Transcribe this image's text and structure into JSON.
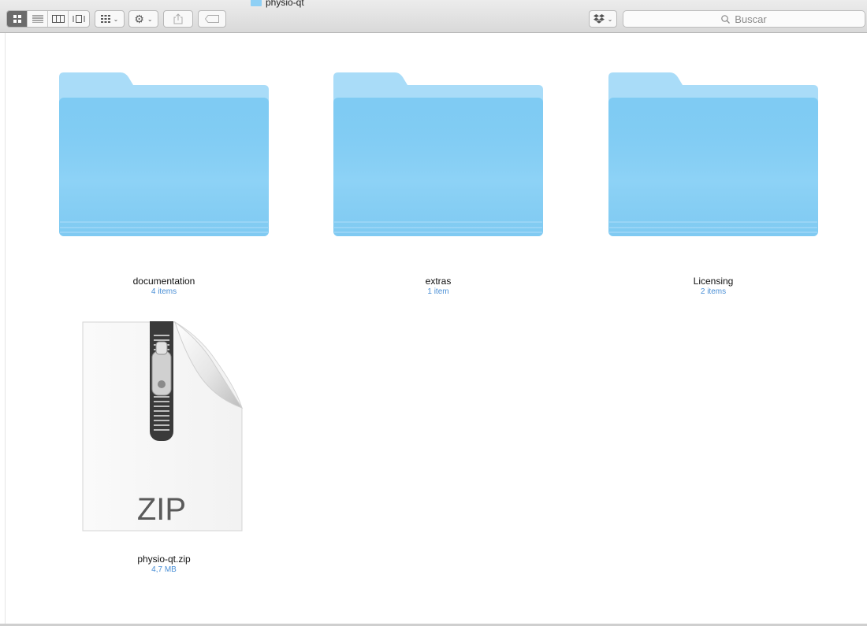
{
  "window": {
    "title": "physio-qt"
  },
  "toolbar": {
    "view_buttons": [
      "icon-view-icon",
      "list-view-icon",
      "column-view-icon",
      "cover-flow-view-icon"
    ],
    "arrange_icon": "arrange-icon",
    "action_icon": "gear-icon",
    "share_icon": "share-icon",
    "tag_icon": "tag-icon",
    "dropbox_icon": "dropbox-icon"
  },
  "search": {
    "placeholder": "Buscar"
  },
  "items": [
    {
      "name": "documentation",
      "sub": "4 items",
      "kind": "folder"
    },
    {
      "name": "extras",
      "sub": "1 item",
      "kind": "folder"
    },
    {
      "name": "Licensing",
      "sub": "2 items",
      "kind": "folder"
    },
    {
      "name": "physio-qt.zip",
      "sub": "4,7 MB",
      "kind": "zip",
      "badge": "ZIP"
    }
  ],
  "colors": {
    "folder_light": "#a9dcf8",
    "folder_main": "#7fcbf3",
    "sub_text": "#4a8fd6"
  }
}
